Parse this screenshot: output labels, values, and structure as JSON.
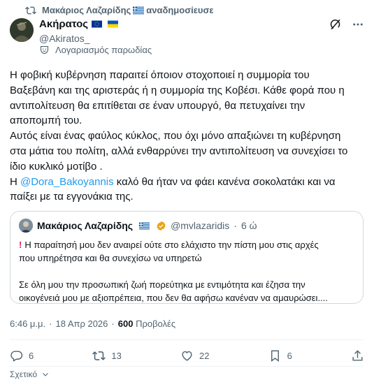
{
  "repost": {
    "name": "Μακάριος Λαζαρίδης",
    "suffix": "αναδημοσίευσε"
  },
  "author": {
    "display_name": "Ακήρατος",
    "handle": "@Akiratos_",
    "badge": "Λογαριασμός παρωδίας"
  },
  "tweet": {
    "text_part1": "Η φοβική κυβέρνηση παραιτεί όποιον στοχοποιεί η συμμορία του\nΒαξεβάνη και της αριστεράς ή η συμμορία της Κοβέσι. Κάθε φορά που η\nαντιπολίτευση θα επιτίθεται σε έναν υπουργό, θα πετυχαίνει την\nαποπομπή του.\nΑυτός είναι ένας φαύλος κύκλος, που όχι μόνο απαξιώνει τη κυβέρνηση\nστα μάτια του πολίτη, αλλά ενθαρρύνει την αντιπολίτευση να συνεχίσει το\nίδιο κυκλικό μοτίβο .\nΗ ",
    "mention": "@Dora_Bakoyannis",
    "text_part2": " καλό θα ήταν να φάει κανένα σοκολατάκι και να\nπαίξει με τα εγγονάκια της."
  },
  "quote": {
    "name": "Μακάριος Λαζαρίδης",
    "handle": "@mvlazaridis",
    "separator": "·",
    "time": "6 ώ",
    "exclamation": "!",
    "text": "Η παραίτησή μου δεν αναιρεί ούτε στο ελάχιστο την πίστη μου στις αρχές\nπου υπηρέτησα και θα συνεχίσω να υπηρετώ\n\nΣε όλη μου την προσωπική ζωή πορεύτηκα με εντιμότητα και έζησα την\nοικογένειά μου με αξιοπρέπεια, που δεν θα αφήσω κανέναν να αμαυρώσει...."
  },
  "meta": {
    "time": "6:46 μ.μ.",
    "separator": "·",
    "date": "18 Απρ 2026",
    "separator2": "·",
    "views_count": "600",
    "views_label": "Προβολές"
  },
  "actions": {
    "replies": "6",
    "reposts": "13",
    "likes": "22",
    "bookmarks": "6"
  },
  "related_label": "Σχετικό",
  "colors": {
    "accent": "#1d9bf0",
    "muted": "#536471",
    "text": "#0f1419",
    "border": "#cfd9de"
  },
  "icons": [
    "repost-icon",
    "greece-flag-icon",
    "eu-flag-icon",
    "ukraine-flag-icon",
    "grok-icon",
    "more-icon",
    "parody-mask-icon",
    "verified-icon",
    "reply-icon",
    "like-icon",
    "bookmark-icon",
    "share-icon",
    "chevron-down-icon"
  ]
}
